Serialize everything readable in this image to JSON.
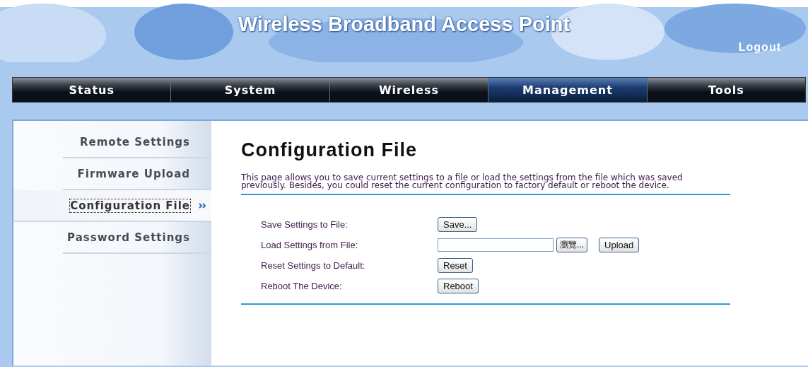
{
  "header": {
    "title": "Wireless Broadband Access Point",
    "logout": "Logout"
  },
  "nav": [
    {
      "label": "Status",
      "selected": false
    },
    {
      "label": "System",
      "selected": false
    },
    {
      "label": "Wireless",
      "selected": false
    },
    {
      "label": "Management",
      "selected": true
    },
    {
      "label": "Tools",
      "selected": false
    }
  ],
  "sidebar": {
    "items": [
      {
        "label": "Remote Settings",
        "selected": false
      },
      {
        "label": "Firmware Upload",
        "selected": false
      },
      {
        "label": "Configuration File",
        "selected": true
      },
      {
        "label": "Password Settings",
        "selected": false
      }
    ]
  },
  "content": {
    "title": "Configuration File",
    "description": "This page allows you to save current settings to a file or load the settings from the file which was saved previously. Besides, you could reset the current configuration to factory default or reboot the device.",
    "rows": [
      {
        "kind": "button",
        "label": "Save Settings to File:",
        "button": "Save..."
      },
      {
        "kind": "file",
        "label": "Load Settings from File:",
        "browse": "瀏覽...",
        "button": "Upload"
      },
      {
        "kind": "button",
        "label": "Reset Settings to Default:",
        "button": "Reset"
      },
      {
        "kind": "button",
        "label": "Reboot The Device:",
        "button": "Reboot"
      }
    ]
  }
}
